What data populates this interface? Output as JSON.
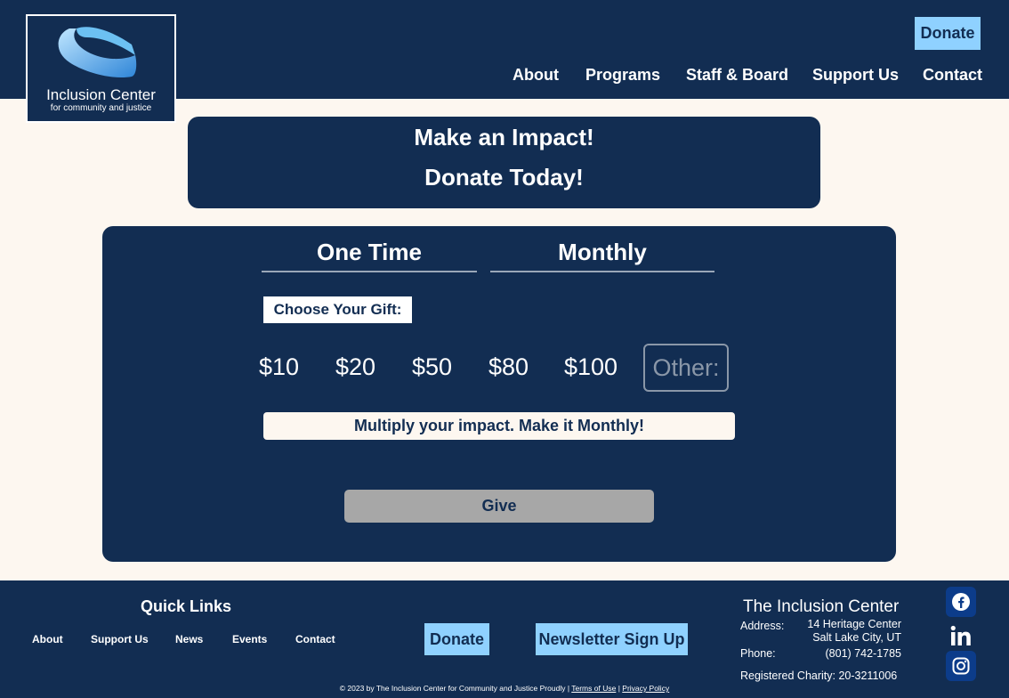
{
  "brand": {
    "title": "Inclusion Center",
    "subtitle": "for community and justice",
    "accent": "#8fd1ff",
    "navy": "#122d52"
  },
  "header": {
    "donate_label": "Donate",
    "nav": [
      "About",
      "Programs",
      "Staff & Board",
      "Support Us",
      "Contact"
    ]
  },
  "banner": {
    "line1": "Make an Impact!",
    "line2": "Donate Today!"
  },
  "donation": {
    "tabs": [
      "One Time",
      "Monthly"
    ],
    "choose_label": "Choose Your Gift:",
    "amounts": [
      "$10",
      "$20",
      "$50",
      "$80",
      "$100"
    ],
    "other_placeholder": "Other:",
    "monthly_prompt": "Multiply your impact. Make it Monthly!",
    "give_label": "Give"
  },
  "footer": {
    "quick_links_title": "Quick Links",
    "quick_links": [
      "About",
      "Support Us",
      "News",
      "Events",
      "Contact"
    ],
    "donate_label": "Donate",
    "newsletter_label": "Newsletter Sign Up",
    "org_name": "The Inclusion Center",
    "address_label": "Address:",
    "address_line1": "14 Heritage Center",
    "address_line2": "Salt Lake City, UT",
    "phone_label": "Phone:",
    "phone": "(801) 742-1785",
    "charity": "Registered Charity: 20-3211006",
    "copyright": "© 2023 by The Inclusion Center for Community and Justice Proudly |",
    "terms": "Terms of Use",
    "separator": "|",
    "privacy": "Privacy Policy",
    "social": [
      "facebook-icon",
      "linkedin-icon",
      "instagram-icon"
    ]
  }
}
